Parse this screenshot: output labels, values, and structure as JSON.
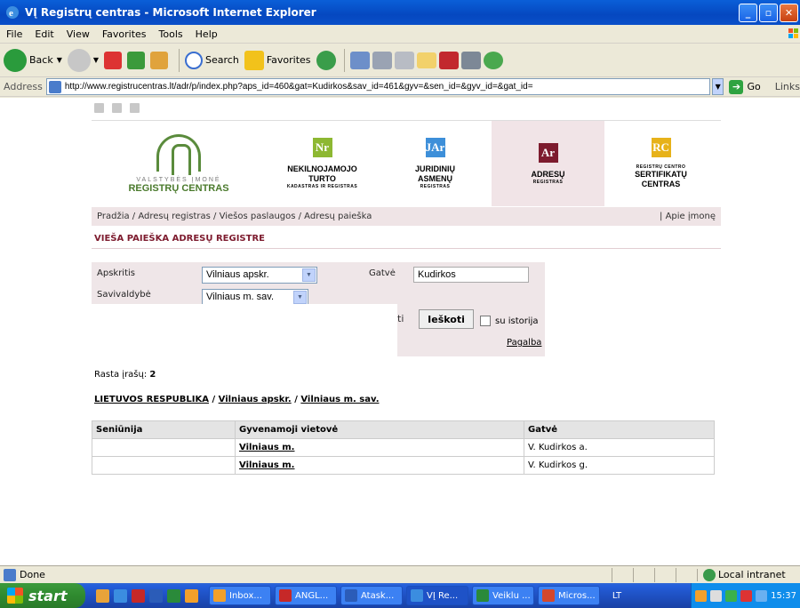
{
  "window": {
    "title": "VĮ Registrų centras - Microsoft Internet Explorer"
  },
  "menu": [
    "File",
    "Edit",
    "View",
    "Favorites",
    "Tools",
    "Help"
  ],
  "toolbar": {
    "back": "Back",
    "search": "Search",
    "favorites": "Favorites"
  },
  "address": {
    "label": "Address",
    "url": "http://www.registrucentras.lt/adr/p/index.php?aps_id=460&gat=Kudirkos&sav_id=461&gyv=&sen_id=&gyv_id=&gat_id=",
    "go": "Go",
    "links": "Links"
  },
  "site": {
    "logos": {
      "main_sub": "VALSTYBĖS ĮMONĖ",
      "main_name": "REGISTRŲ CENTRAS",
      "nt_title_1": "NEKILNOJAMOJO",
      "nt_title_2": "TURTO",
      "nt_sub": "KADASTRAS IR REGISTRAS",
      "ja_title_1": "JURIDINIŲ",
      "ja_title_2": "ASMENŲ",
      "ja_sub": "REGISTRAS",
      "adr_title": "ADRESŲ",
      "adr_sub": "REGISTRAS",
      "sc_sub": "REGISTRŲ CENTRO",
      "sc_title_1": "SERTIFIKATŲ",
      "sc_title_2": "CENTRAS"
    },
    "breadcrumb": "Pradžia / Adresų registras / Viešos paslaugos / Adresų paieška",
    "about": "| Apie įmonę",
    "heading": "VIEŠA PAIEŠKA ADRESŲ REGISTRE",
    "form": {
      "county_label": "Apskritis",
      "county_value": "Vilniaus apskr.",
      "street_label": "Gatvė",
      "street_value": "Kudirkos",
      "municipality_label": "Savivaldybė",
      "municipality_value": "Vilniaus m. sav.",
      "clear_partial": "ti",
      "search_button": "Ieškoti",
      "history_label": "su istorija",
      "help": "Pagalba"
    },
    "results": {
      "count_label": "Rasta įrašų:",
      "count": "2",
      "path": [
        "LIETUVOS RESPUBLIKA",
        "Vilniaus apskr.",
        "Vilniaus m. sav."
      ],
      "path_sep": "/",
      "headers": [
        "Seniūnija",
        "Gyvenamoji vietovė",
        "Gatvė"
      ],
      "rows": [
        {
          "eldership": "",
          "town": "Vilniaus m.",
          "street": "V. Kudirkos a."
        },
        {
          "eldership": "",
          "town": "Vilniaus m.",
          "street": "V. Kudirkos g."
        }
      ]
    }
  },
  "status": {
    "text": "Done",
    "zone": "Local intranet"
  },
  "taskbar": {
    "start": "start",
    "tasks": [
      "Inbox...",
      "ANGL...",
      "Atask...",
      "VĮ Re...",
      "Veiklu ...",
      "Micros..."
    ],
    "lang": "LT",
    "clock": "15:37"
  },
  "colors": {
    "accent": "#7d1b2e",
    "panel": "#efe6e8",
    "rc_green": "#5a8b3c",
    "nt_green": "#8db832",
    "ja_blue": "#3d8fd9",
    "adr_maroon": "#7d1b2e",
    "sc_yellow": "#e7b21a"
  }
}
